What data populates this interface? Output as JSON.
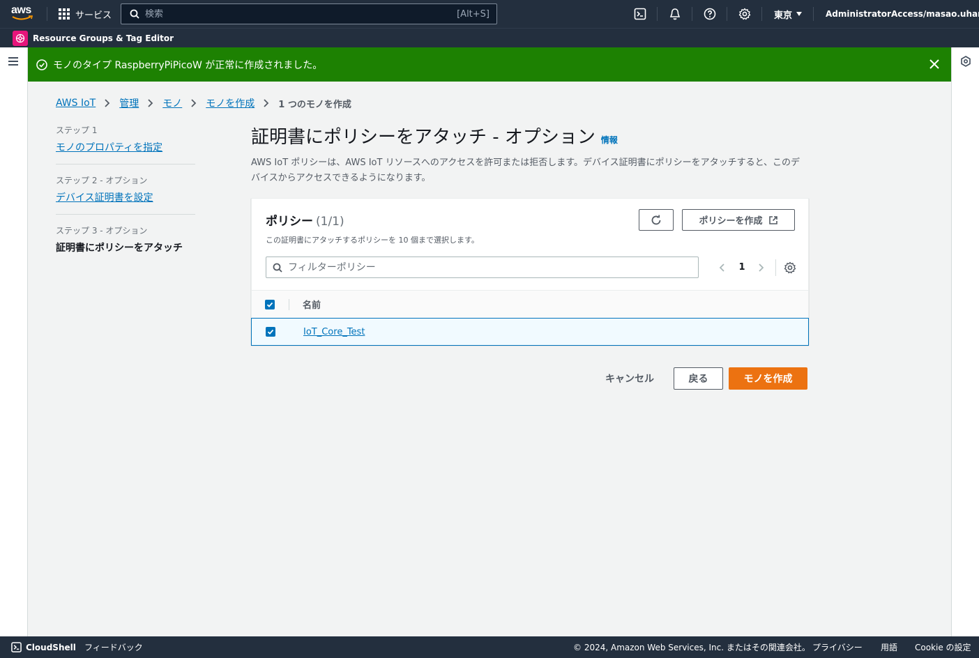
{
  "topnav": {
    "logo_text": "aws",
    "services_label": "サービス",
    "search_placeholder": "検索",
    "search_shortcut": "[Alt+S]",
    "region": "東京",
    "account": "AdministratorAccess/masao.uhara"
  },
  "subnav": {
    "favorite_label": "Resource Groups & Tag Editor"
  },
  "flash": {
    "message": "モノのタイプ RaspberryPiPicoW が正常に作成されました。",
    "color": "#1d8102"
  },
  "breadcrumb": {
    "items": [
      "AWS IoT",
      "管理",
      "モノ",
      "モノを作成"
    ],
    "current": "1 つのモノを作成"
  },
  "steps": [
    {
      "num": "ステップ 1",
      "label": "モノのプロパティを指定"
    },
    {
      "num": "ステップ 2 - オプション",
      "label": "デバイス証明書を設定"
    },
    {
      "num": "ステップ 3 - オプション",
      "label": "証明書にポリシーをアタッチ"
    }
  ],
  "main": {
    "title": "証明書にポリシーをアタッチ - オプション",
    "info": "情報",
    "description": "AWS IoT ポリシーは、AWS IoT リソースへのアクセスを許可または拒否します。デバイス証明書にポリシーをアタッチすると、このデバイスからアクセスできるようになります。"
  },
  "policies": {
    "title": "ポリシー",
    "count": "(1/1)",
    "subtitle": "この証明書にアタッチするポリシーを 10 個まで選択します。",
    "create_button": "ポリシーを作成",
    "filter_placeholder": "フィルターポリシー",
    "page": "1",
    "column_name": "名前",
    "rows": [
      {
        "name": "IoT_Core_Test",
        "selected": true
      }
    ]
  },
  "actions": {
    "cancel": "キャンセル",
    "back": "戻る",
    "create": "モノを作成",
    "primary_color": "#ec7211"
  },
  "footer": {
    "cloudshell": "CloudShell",
    "feedback": "フィードバック",
    "copyright": "© 2024, Amazon Web Services, Inc. またはその関連会社。",
    "privacy": "プライバシー",
    "terms": "用語",
    "cookie": "Cookie の設定"
  }
}
